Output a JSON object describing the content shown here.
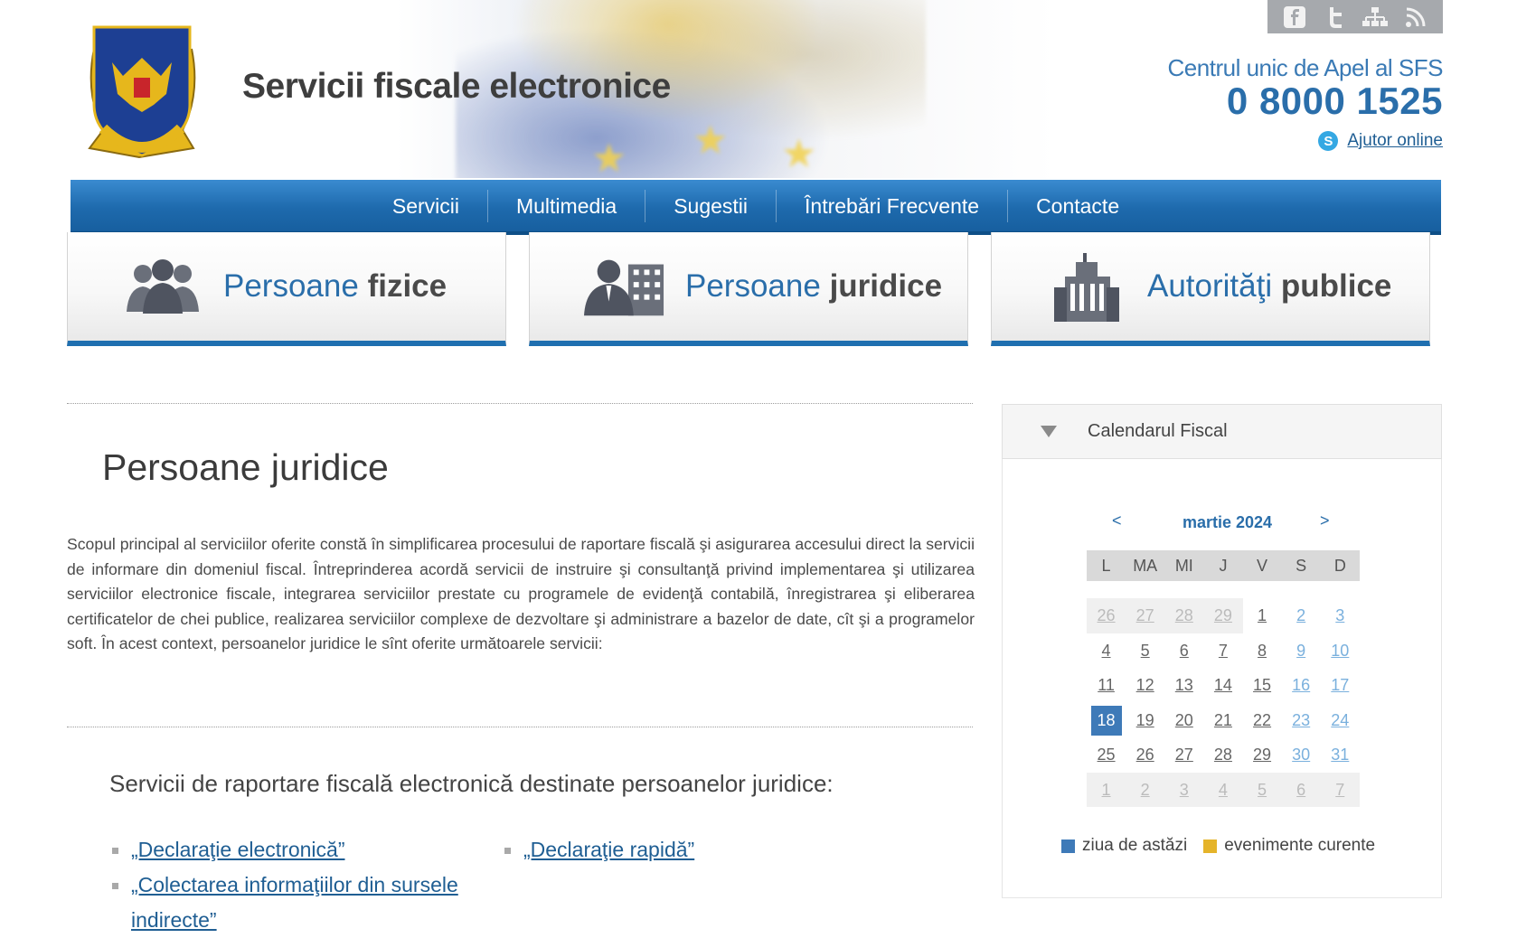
{
  "header": {
    "site_title": "Servicii fiscale electronice",
    "callcenter_label": "Centrul unic de Apel al SFS",
    "phone": "0 8000 1525",
    "help_online": "Ajutor online",
    "social_icons": [
      "facebook-icon",
      "twitter-icon",
      "sitemap-icon",
      "rss-icon"
    ]
  },
  "nav": {
    "items": [
      "Servicii",
      "Multimedia",
      "Sugestii",
      "Întrebări Frecvente",
      "Contacte"
    ]
  },
  "tiles": [
    {
      "word1": "Persoane ",
      "word2": "fizice",
      "icon": "people-group-icon"
    },
    {
      "word1": "Persoane ",
      "word2": "juridice",
      "icon": "businessman-building-icon"
    },
    {
      "word1": "Autorităţi ",
      "word2": "publice",
      "icon": "government-building-icon"
    }
  ],
  "main": {
    "title": "Persoane juridice",
    "intro": "Scopul principal al serviciilor oferite constă în simplificarea procesului de raportare fiscală şi asigurarea accesului direct la servicii de informare din domeniul fiscal. Întreprinderea acordă servicii de instruire şi consultanţă privind implementarea şi utilizarea serviciilor electronice fiscale, integrarea serviciilor prestate cu programele de evidenţă contabilă, înregistrarea şi eliberarea certificatelor de chei publice, realizarea serviciilor complexe de dezvoltare şi administrare a bazelor de date, cît şi a programelor soft. În acest context, persoanelor juridice le sînt oferite următoarele servicii:",
    "services_heading": "Servicii de raportare fiscală electronică destinate persoanelor juridice:",
    "services": [
      {
        "label": "„Declaraţie electronică”"
      },
      {
        "label": "„Colectarea informaţiilor din sursele"
      },
      {
        "label": "indirecte”"
      },
      {
        "label": "„Declaraţie rapidă”"
      }
    ]
  },
  "calendar": {
    "title": "Calendarul Fiscal",
    "prev": "<",
    "next": ">",
    "month_label": "martie 2024",
    "weekdays": [
      "L",
      "MA",
      "MI",
      "J",
      "V",
      "S",
      "D"
    ],
    "weeks": [
      [
        "26",
        "27",
        "28",
        "29",
        "1",
        "2",
        "3"
      ],
      [
        "4",
        "5",
        "6",
        "7",
        "8",
        "9",
        "10"
      ],
      [
        "11",
        "12",
        "13",
        "14",
        "15",
        "16",
        "17"
      ],
      [
        "18",
        "19",
        "20",
        "21",
        "22",
        "23",
        "24"
      ],
      [
        "25",
        "26",
        "27",
        "28",
        "29",
        "30",
        "31"
      ],
      [
        "1",
        "2",
        "3",
        "4",
        "5",
        "6",
        "7"
      ]
    ],
    "other_month_cells": [
      [
        0,
        0
      ],
      [
        0,
        1
      ],
      [
        0,
        2
      ],
      [
        0,
        3
      ],
      [
        5,
        0
      ],
      [
        5,
        1
      ],
      [
        5,
        2
      ],
      [
        5,
        3
      ],
      [
        5,
        4
      ],
      [
        5,
        5
      ],
      [
        5,
        6
      ]
    ],
    "today": "18",
    "legend": [
      {
        "label": "ziua de astăzi",
        "color": "#3e7ab8"
      },
      {
        "label": "evenimente curente",
        "color": "#e5b42a"
      }
    ]
  }
}
